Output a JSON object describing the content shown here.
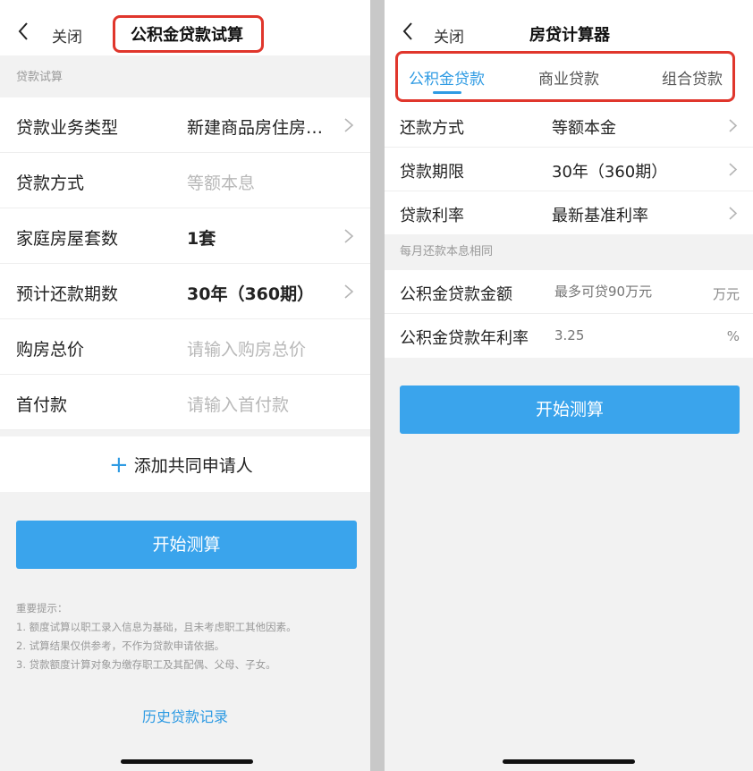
{
  "left": {
    "close_label": "关闭",
    "title": "公积金贷款试算",
    "section_label": "贷款试算",
    "rows": [
      {
        "label": "贷款业务类型",
        "value": "新建商品房住房…"
      },
      {
        "label": "贷款方式",
        "value": "等额本息"
      },
      {
        "label": "家庭房屋套数",
        "value": "1套"
      },
      {
        "label": "预计还款期数",
        "value": "30年（360期）"
      },
      {
        "label": "购房总价",
        "placeholder": "请输入购房总价"
      },
      {
        "label": "首付款",
        "placeholder": "请输入首付款"
      }
    ],
    "add_applicant_icon": "+",
    "add_applicant_label": "添加共同申请人",
    "calc_button": "开始测算",
    "notes": [
      "重要提示：",
      "1. 额度试算以职工录入信息为基础，且未考虑职工其他因素。",
      "2. 试算结果仅供参考，不作为贷款申请依据。",
      "3. 贷款额度计算对象为缴存职工及其配偶、父母、子女。"
    ],
    "history_link": "历史贷款记录"
  },
  "right": {
    "close_label": "关闭",
    "title": "房贷计算器",
    "tabs": [
      {
        "label": "公积金贷款",
        "active": true
      },
      {
        "label": "商业贷款",
        "active": false
      },
      {
        "label": "组合贷款",
        "active": false
      }
    ],
    "rows": [
      {
        "label": "还款方式",
        "value": "等额本金"
      },
      {
        "label": "贷款期限",
        "value": "30年（360期）"
      },
      {
        "label": "贷款利率",
        "value": "最新基准利率"
      }
    ],
    "section_label": "每月还款本息相同",
    "amount": {
      "label": "公积金贷款金额",
      "placeholder": "最多可贷90万元",
      "unit": "万元"
    },
    "rate": {
      "label": "公积金贷款年利率",
      "placeholder": "3.25",
      "unit": "%"
    },
    "calc_button": "开始测算"
  },
  "colors": {
    "accent": "#2f9be3",
    "button": "#3aa4ec",
    "highlight_box": "#e0362c",
    "section_bg": "#f2f2f2"
  },
  "icons": [
    "back-icon",
    "chevron-right-icon",
    "plus-icon"
  ]
}
